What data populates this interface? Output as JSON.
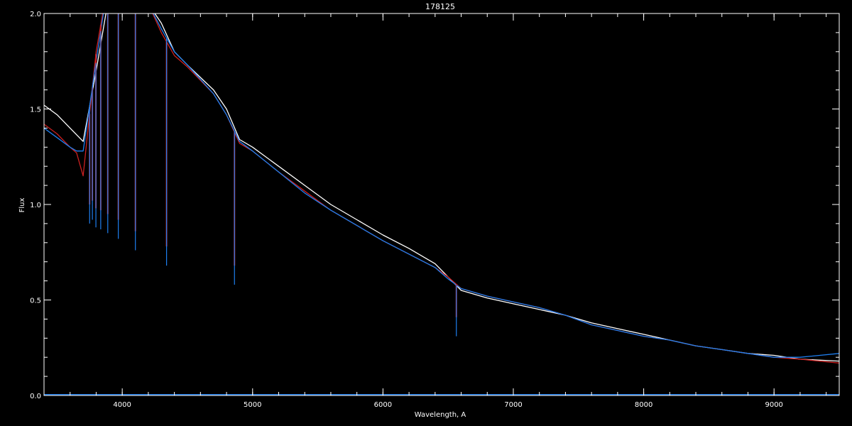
{
  "chart_data": {
    "type": "line",
    "title": "178125",
    "xlabel": "Wavelength, A",
    "ylabel": "Flux",
    "xlim": [
      3400,
      9500
    ],
    "ylim": [
      0.0,
      2.0
    ],
    "x_ticks": [
      4000,
      5000,
      6000,
      7000,
      8000,
      9000
    ],
    "x_tick_labels": [
      "4000",
      "5000",
      "6000",
      "7000",
      "8000",
      "9000"
    ],
    "y_ticks": [
      0.0,
      0.5,
      1.0,
      1.5,
      2.0
    ],
    "y_tick_labels": [
      "0.0",
      "0.5",
      "1.0",
      "1.5",
      "2.0"
    ],
    "grid": false,
    "background": "#000000",
    "axis_color": "#ffffff",
    "series": [
      {
        "color": "#ffffff",
        "x": [
          3400,
          3500,
          3600,
          3700,
          3800,
          3900,
          4000,
          4100,
          4200,
          4300,
          4400,
          4500,
          4700,
          4800,
          4900,
          5000,
          5200,
          5400,
          5600,
          5800,
          6000,
          6200,
          6400,
          6500,
          6600,
          6700,
          6800,
          7000,
          7200,
          7400,
          7600,
          7800,
          8000,
          8200,
          8400,
          8600,
          8800,
          9000,
          9200,
          9500
        ],
        "y": [
          1.52,
          1.47,
          1.4,
          1.33,
          1.7,
          2.1,
          2.2,
          2.2,
          2.05,
          1.95,
          1.8,
          1.73,
          1.6,
          1.5,
          1.34,
          1.3,
          1.2,
          1.1,
          1.0,
          0.92,
          0.84,
          0.77,
          0.69,
          0.62,
          0.55,
          0.53,
          0.51,
          0.48,
          0.45,
          0.42,
          0.38,
          0.35,
          0.32,
          0.29,
          0.26,
          0.24,
          0.22,
          0.21,
          0.19,
          0.18
        ]
      },
      {
        "color": "#cc2020",
        "x": [
          3400,
          3500,
          3600,
          3650,
          3700,
          3800,
          3900,
          4000,
          4100,
          4200,
          4300,
          4400,
          4500,
          4700,
          4800,
          4900,
          5000,
          5200,
          5400,
          5600,
          5800,
          6000,
          6200,
          6400,
          6500,
          6600,
          6700,
          6800,
          7000,
          7200,
          7400,
          7600,
          7800,
          8000,
          8200,
          8400,
          8600,
          8800,
          9000,
          9200,
          9500
        ],
        "y": [
          1.42,
          1.37,
          1.3,
          1.27,
          1.15,
          1.8,
          2.2,
          2.2,
          2.2,
          2.05,
          1.9,
          1.78,
          1.72,
          1.58,
          1.47,
          1.32,
          1.28,
          1.17,
          1.07,
          0.97,
          0.89,
          0.81,
          0.74,
          0.67,
          0.62,
          0.56,
          0.54,
          0.52,
          0.49,
          0.46,
          0.42,
          0.37,
          0.34,
          0.31,
          0.29,
          0.26,
          0.24,
          0.22,
          0.2,
          0.19,
          0.17
        ]
      },
      {
        "color": "#1e7ff0",
        "x": [
          3400,
          3500,
          3600,
          3650,
          3700,
          3800,
          3900,
          4000,
          4100,
          4200,
          4300,
          4400,
          4500,
          4700,
          4800,
          4900,
          5000,
          5200,
          5400,
          5600,
          5800,
          6000,
          6200,
          6400,
          6500,
          6600,
          6700,
          6800,
          7000,
          7200,
          7400,
          7600,
          7800,
          8000,
          8200,
          8400,
          8600,
          8800,
          9000,
          9200,
          9500
        ],
        "y": [
          1.4,
          1.35,
          1.3,
          1.28,
          1.28,
          1.75,
          2.2,
          2.2,
          2.2,
          2.05,
          1.92,
          1.8,
          1.73,
          1.58,
          1.47,
          1.33,
          1.28,
          1.17,
          1.06,
          0.97,
          0.89,
          0.81,
          0.74,
          0.67,
          0.61,
          0.56,
          0.54,
          0.52,
          0.49,
          0.46,
          0.42,
          0.37,
          0.34,
          0.31,
          0.29,
          0.26,
          0.24,
          0.22,
          0.2,
          0.2,
          0.22
        ]
      },
      {
        "color": "#1e7ff0",
        "x": [
          3400,
          9500
        ],
        "y": [
          0.005,
          0.005
        ]
      }
    ],
    "absorption_lines": [
      {
        "x": 3750,
        "y_min": 0.9
      },
      {
        "x": 3771,
        "y_min": 0.92
      },
      {
        "x": 3798,
        "y_min": 0.88
      },
      {
        "x": 3835,
        "y_min": 0.87
      },
      {
        "x": 3889,
        "y_min": 0.85
      },
      {
        "x": 3970,
        "y_min": 0.82
      },
      {
        "x": 4101,
        "y_min": 0.76
      },
      {
        "x": 4340,
        "y_min": 0.68
      },
      {
        "x": 4861,
        "y_min": 0.58
      },
      {
        "x": 6563,
        "y_min": 0.31
      }
    ]
  }
}
